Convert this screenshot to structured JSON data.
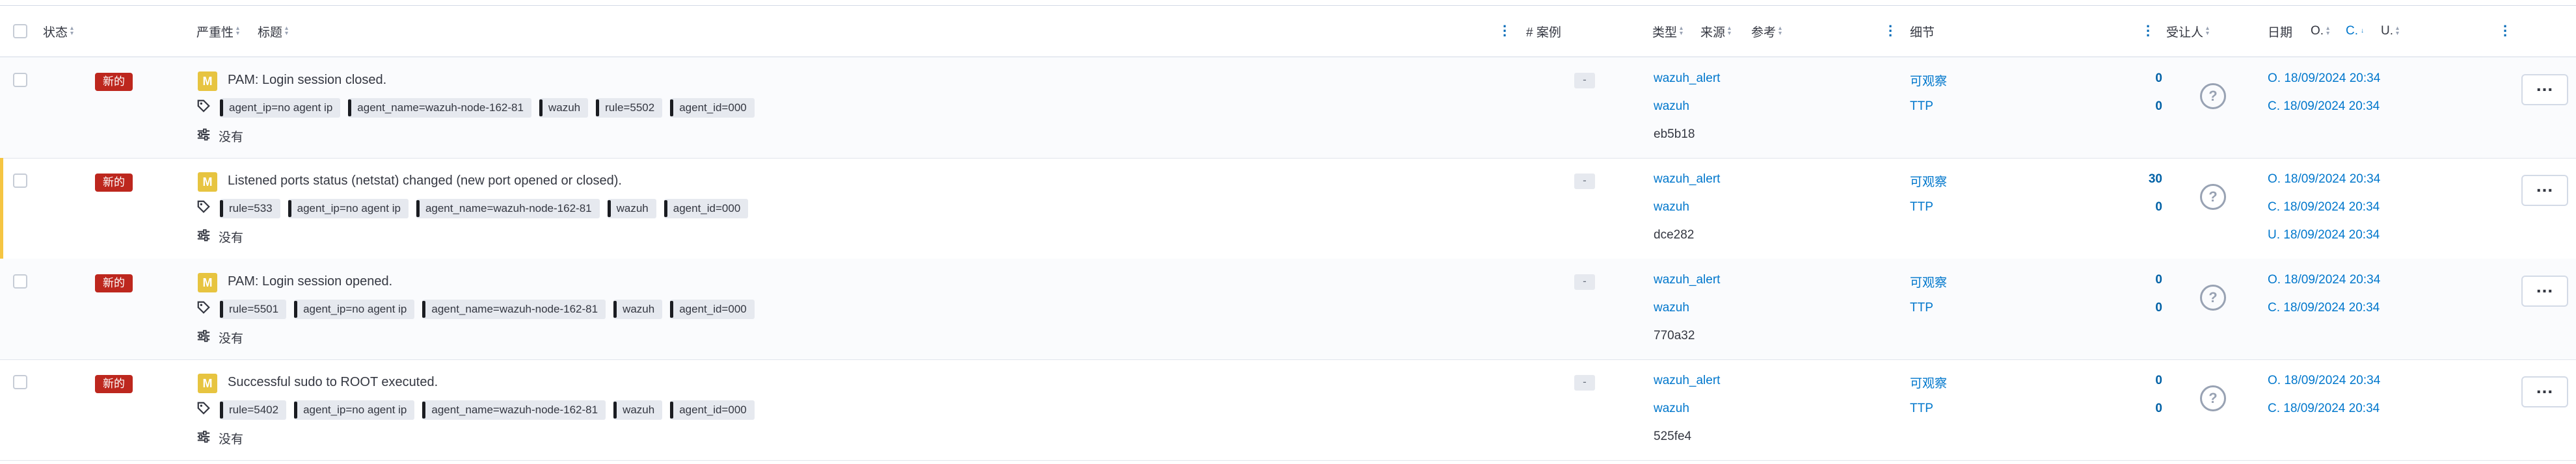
{
  "header": {
    "status": "状态",
    "severity": "严重性",
    "title": "标题",
    "cases": "# 案例",
    "type": "类型",
    "source": "来源",
    "reference": "参考",
    "details": "细节",
    "assignee": "受让人",
    "date": "日期",
    "date_o": "O.",
    "date_c": "C.",
    "date_u": "U."
  },
  "colors": {
    "new_badge": "#bd271e",
    "severity_medium": "#e7c440",
    "link": "#0077cc",
    "row_accent": "#f5c542"
  },
  "no_data_label": "没有",
  "rows": [
    {
      "status": "新的",
      "severity": "M",
      "title": "PAM: Login session closed.",
      "tags": [
        "agent_ip=no agent ip",
        "agent_name=wazuh-node-162-81",
        "wazuh",
        "rule=5502",
        "agent_id=000"
      ],
      "cases": "-",
      "type": "wazuh_alert",
      "source": "wazuh",
      "reference": "eb5b18",
      "detail_observable": "可观察",
      "detail_observable_count": "0",
      "detail_ttp": "TTP",
      "detail_ttp_count": "0",
      "date_o": "O. 18/09/2024 20:34",
      "date_c": "C. 18/09/2024 20:34",
      "date_u": ""
    },
    {
      "status": "新的",
      "severity": "M",
      "title": "Listened ports status (netstat) changed (new port opened or closed).",
      "tags": [
        "rule=533",
        "agent_ip=no agent ip",
        "agent_name=wazuh-node-162-81",
        "wazuh",
        "agent_id=000"
      ],
      "cases": "-",
      "type": "wazuh_alert",
      "source": "wazuh",
      "reference": "dce282",
      "detail_observable": "可观察",
      "detail_observable_count": "30",
      "detail_ttp": "TTP",
      "detail_ttp_count": "0",
      "date_o": "O. 18/09/2024 20:34",
      "date_c": "C. 18/09/2024 20:34",
      "date_u": "U. 18/09/2024 20:34"
    },
    {
      "status": "新的",
      "severity": "M",
      "title": "PAM: Login session opened.",
      "tags": [
        "rule=5501",
        "agent_ip=no agent ip",
        "agent_name=wazuh-node-162-81",
        "wazuh",
        "agent_id=000"
      ],
      "cases": "-",
      "type": "wazuh_alert",
      "source": "wazuh",
      "reference": "770a32",
      "detail_observable": "可观察",
      "detail_observable_count": "0",
      "detail_ttp": "TTP",
      "detail_ttp_count": "0",
      "date_o": "O. 18/09/2024 20:34",
      "date_c": "C. 18/09/2024 20:34",
      "date_u": ""
    },
    {
      "status": "新的",
      "severity": "M",
      "title": "Successful sudo to ROOT executed.",
      "tags": [
        "rule=5402",
        "agent_ip=no agent ip",
        "agent_name=wazuh-node-162-81",
        "wazuh",
        "agent_id=000"
      ],
      "cases": "-",
      "type": "wazuh_alert",
      "source": "wazuh",
      "reference": "525fe4",
      "detail_observable": "可观察",
      "detail_observable_count": "0",
      "detail_ttp": "TTP",
      "detail_ttp_count": "0",
      "date_o": "O. 18/09/2024 20:34",
      "date_c": "C. 18/09/2024 20:34",
      "date_u": ""
    }
  ]
}
